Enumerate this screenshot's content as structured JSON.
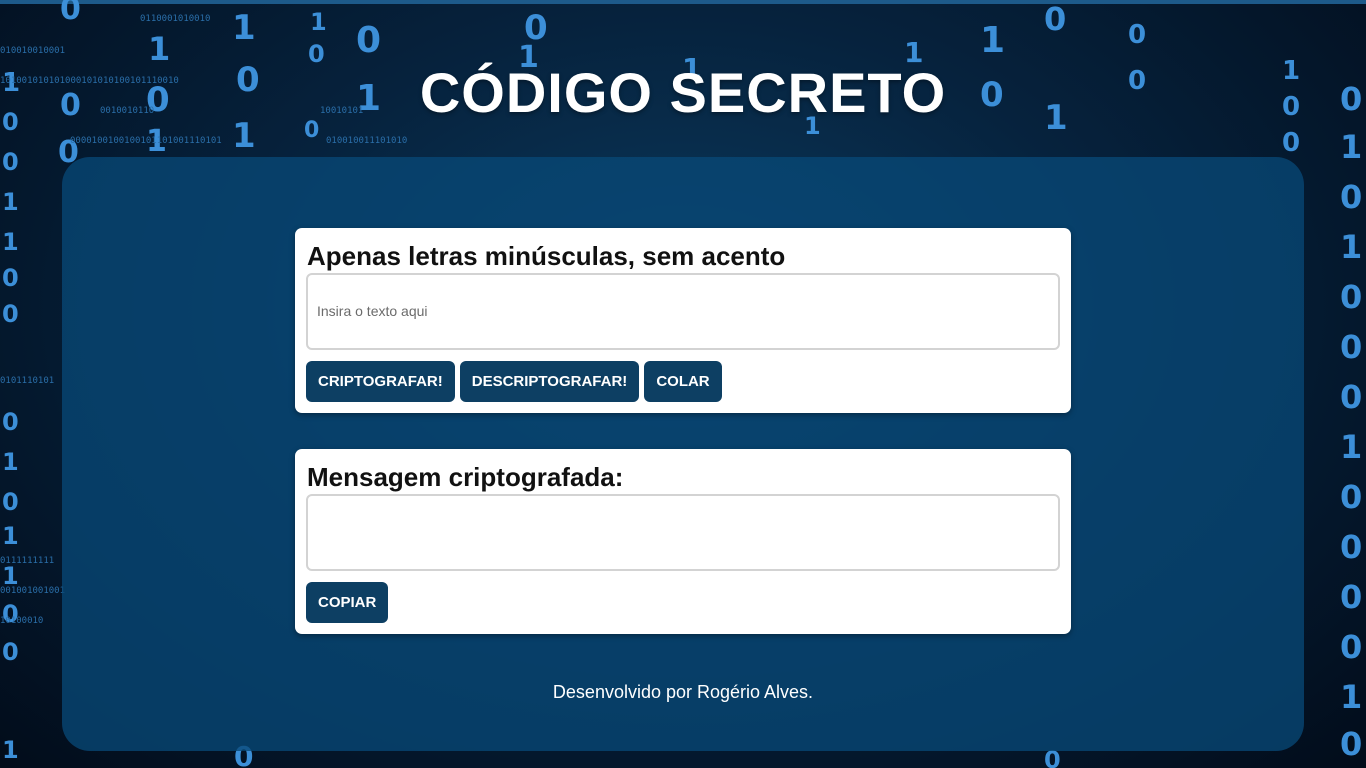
{
  "header": {
    "title": "CÓDIGO SECRETO"
  },
  "encrypt_card": {
    "heading": "Apenas letras minúsculas, sem acento",
    "input_placeholder": "Insira o texto aqui",
    "input_value": "",
    "buttons": {
      "encrypt": "CRIPTOGRAFAR!",
      "decrypt": "DESCRIPTOGRAFAR!",
      "paste": "COLAR"
    }
  },
  "result_card": {
    "heading": "Mensagem criptografada:",
    "output_value": "",
    "copy_button": "COPIAR"
  },
  "footer": {
    "credit": "Desenvolvido por Rogério Alves."
  },
  "colors": {
    "button_bg": "#0d3f63",
    "panel_bg": "#084876",
    "accent_digits": "#3c8fd8"
  }
}
